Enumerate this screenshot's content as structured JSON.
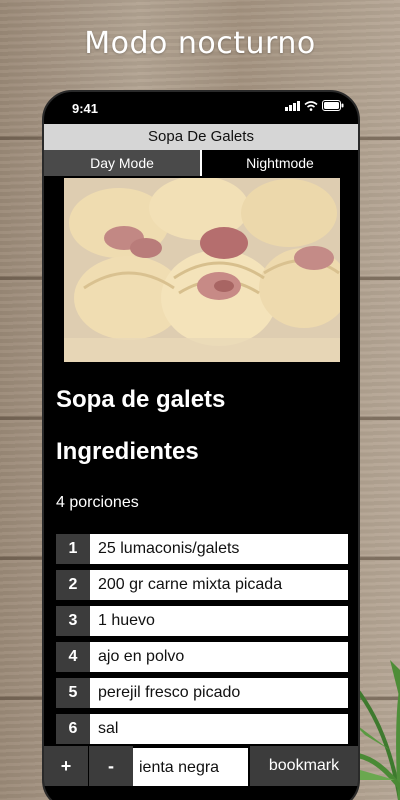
{
  "promo": {
    "headline": "Modo nocturno"
  },
  "status_bar": {
    "time": "9:41"
  },
  "app": {
    "title": "Sopa De Galets",
    "tabs": [
      {
        "label": "Day Mode",
        "active": false
      },
      {
        "label": "Nightmode",
        "active": true
      }
    ]
  },
  "recipe": {
    "name": "Sopa de galets",
    "ingredients_heading": "Ingredientes",
    "servings": "4 porciones",
    "ingredients": [
      {
        "num": "1",
        "text": "25 lumaconis/galets"
      },
      {
        "num": "2",
        "text": "200 gr carne mixta picada"
      },
      {
        "num": "3",
        "text": "1 huevo"
      },
      {
        "num": "4",
        "text": "ajo en polvo"
      },
      {
        "num": "5",
        "text": "perejil fresco picado"
      },
      {
        "num": "6",
        "text": "sal"
      }
    ],
    "partial_item": "ienta negra"
  },
  "bottom_bar": {
    "plus_label": "+",
    "minus_label": "-",
    "bookmark_label": "bookmark"
  },
  "colors": {
    "background": "#000000",
    "title_bar": "#d6d6d6",
    "number_cell": "#3c3c3c",
    "day_tab": "#4a4a4a"
  },
  "icons": [
    "signal-icon",
    "wifi-icon",
    "battery-icon"
  ]
}
